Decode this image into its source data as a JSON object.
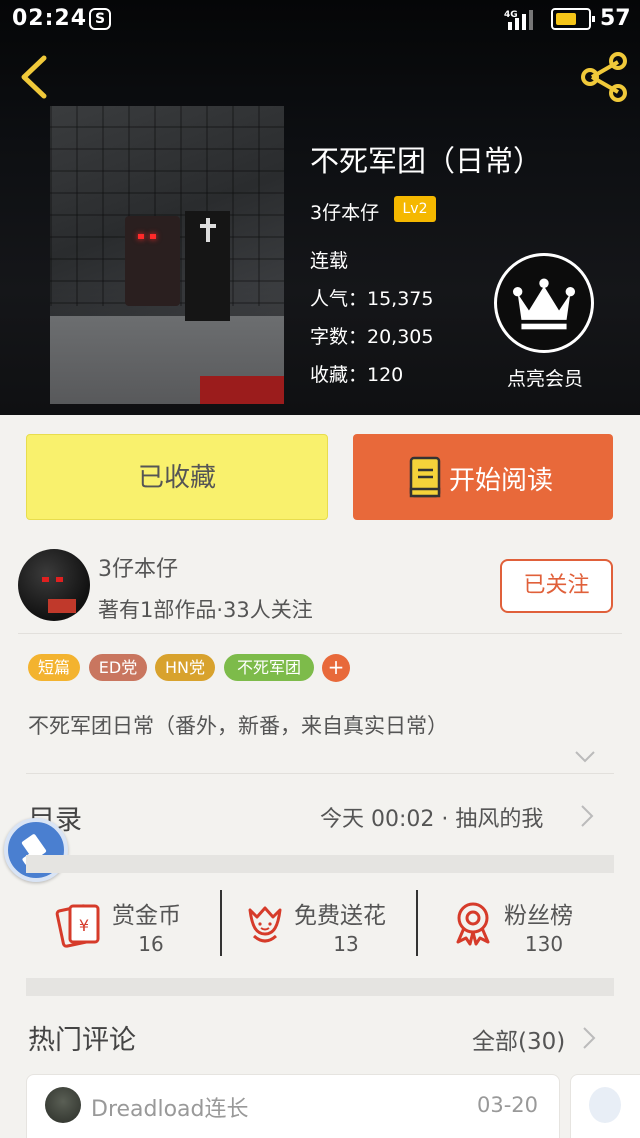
{
  "status_bar": {
    "time": "02:24",
    "app_glyph": "S",
    "network": "4G",
    "battery_pct": "57"
  },
  "book": {
    "title": "不死军团（日常）",
    "author": "3仔本仔",
    "level": "Lv2",
    "status": "连载",
    "popularity": "人气：15,375",
    "word_count": "字数：20,305",
    "favorites": "收藏：120"
  },
  "vip": {
    "label": "点亮会员"
  },
  "actions": {
    "collected_label": "已收藏",
    "read_label": "开始阅读"
  },
  "author_card": {
    "name": "3仔本仔",
    "stats": "著有1部作品·33人关注",
    "follow_label": "已关注"
  },
  "tags": [
    {
      "label": "短篇",
      "color": "#f3b32f"
    },
    {
      "label": "ED党",
      "color": "#c9765f"
    },
    {
      "label": "HN党",
      "color": "#d8a22d"
    },
    {
      "label": "不死军团",
      "color": "#7dbb4a"
    }
  ],
  "tag_add_label": "+",
  "description": "不死军团日常（番外，新番，来自真实日常）",
  "catalog": {
    "title": "目录",
    "latest": "今天 00:02 · 抽风的我"
  },
  "stats": [
    {
      "label": "赏金币",
      "value": "16"
    },
    {
      "label": "免费送花",
      "value": "13"
    },
    {
      "label": "粉丝榜",
      "value": "130"
    }
  ],
  "comments": {
    "title": "热门评论",
    "see_all": "全部(30)",
    "items": [
      {
        "user": "Dreadload连长",
        "date": "03-20"
      }
    ]
  },
  "colors": {
    "accent": "#e8693a",
    "collected_bg": "#f9f16d",
    "level_badge": "#f5b800"
  }
}
